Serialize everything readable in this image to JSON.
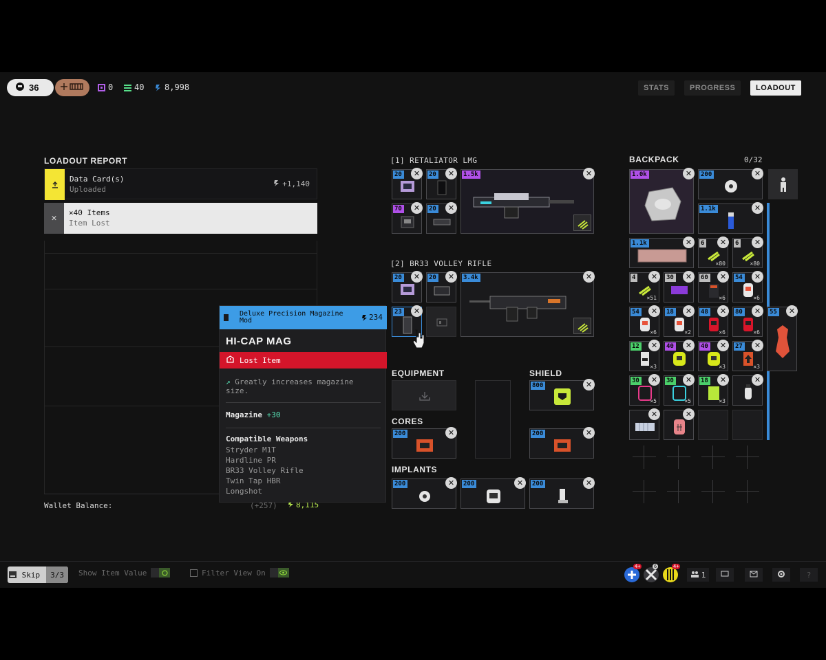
{
  "topbar": {
    "level": "36",
    "currencies": [
      {
        "icon": "data-chip-icon",
        "value": "0",
        "color": "#b15ee8"
      },
      {
        "icon": "stack-icon",
        "value": "40",
        "color": "#57e08a"
      },
      {
        "icon": "credits-icon",
        "value": "8,998",
        "color": "#3a8bd8"
      }
    ],
    "nav": [
      "STATS",
      "PROGRESS",
      "LOADOUT"
    ],
    "active_nav": "LOADOUT"
  },
  "report": {
    "title": "LOADOUT REPORT",
    "rows": [
      {
        "title": "Data Card(s)",
        "sub": "Uploaded",
        "amount": "+1,140",
        "icon": "upload-icon"
      },
      {
        "title": "×40 Items",
        "sub": "Item Lost",
        "icon": "close-icon"
      }
    ],
    "wallet_label": "Wallet Balance:",
    "wallet_delta": "(+257)",
    "wallet_total": "8,115"
  },
  "weapons": [
    {
      "title": "[1] RETALIATOR LMG",
      "mods": [
        "20",
        "20",
        "70",
        "20"
      ],
      "main_value": "1.5k"
    },
    {
      "title": "[2] BR33 VOLLEY RIFLE",
      "mods": [
        "20",
        "20",
        "23"
      ],
      "main_value": "3.4k"
    }
  ],
  "equipment": {
    "equipment_label": "EQUIPMENT",
    "shield_label": "SHIELD",
    "shield_value": "800",
    "cores_label": "CORES",
    "cores_values": [
      "200",
      "200"
    ],
    "implants_label": "IMPLANTS",
    "implants_values": [
      "200",
      "200",
      "200"
    ]
  },
  "backpack": {
    "title": "BACKPACK",
    "count": "0/32",
    "items": [
      {
        "value": "1.0k",
        "color": "purple"
      },
      {
        "value": "200",
        "color": "blue"
      },
      {
        "value": "1.1k",
        "color": "blue"
      },
      {
        "value": "1.1k",
        "color": "blue"
      },
      {
        "value": "6",
        "color": "gray",
        "qty": "×80"
      },
      {
        "value": "6",
        "color": "gray",
        "qty": "×80"
      },
      {
        "value": "4",
        "color": "gray",
        "qty": "×51"
      },
      {
        "value": "30",
        "color": "gray"
      },
      {
        "value": "60",
        "color": "gray",
        "qty": "×6"
      },
      {
        "value": "54",
        "color": "blue",
        "qty": "×6"
      },
      {
        "value": "54",
        "color": "blue",
        "qty": "×6"
      },
      {
        "value": "18",
        "color": "blue",
        "qty": "×2"
      },
      {
        "value": "48",
        "color": "blue",
        "qty": "×6"
      },
      {
        "value": "80",
        "color": "blue",
        "qty": "×6"
      },
      {
        "value": "55",
        "color": "blue"
      },
      {
        "value": "12",
        "color": "green",
        "qty": "×3"
      },
      {
        "value": "40",
        "color": "purple"
      },
      {
        "value": "40",
        "color": "purple",
        "qty": "×3"
      },
      {
        "value": "27",
        "color": "blue",
        "qty": "×3"
      },
      {
        "value": "30",
        "color": "green",
        "qty": "×5"
      },
      {
        "value": "30",
        "color": "green",
        "qty": "×5"
      },
      {
        "value": "18",
        "color": "green",
        "qty": "×3"
      }
    ]
  },
  "tooltip": {
    "category": "Deluxe Precision Magazine Mod",
    "value": "234",
    "name": "HI-CAP MAG",
    "status": "Lost Item",
    "description": "Greatly increases magazine size.",
    "stat_label": "Magazine",
    "stat_value": "+30",
    "compat_title": "Compatible Weapons",
    "compat": [
      "Stryder M1T",
      "Hardline PR",
      "BR33 Volley Rifle",
      "Twin Tap HBR",
      "Longshot"
    ]
  },
  "bottombar": {
    "skip_label": "Skip",
    "skip_count": "3/3",
    "show_value_label": "Show Item Value",
    "filter_label": "Filter View On",
    "party_count": "1",
    "crew_badges": [
      "4+",
      "6",
      "4+"
    ]
  },
  "colors": {
    "accent_blue": "#3a8bd8",
    "lost_red": "#d4152a",
    "report_yellow": "#f4e534",
    "stat_green": "#57e0b4"
  }
}
